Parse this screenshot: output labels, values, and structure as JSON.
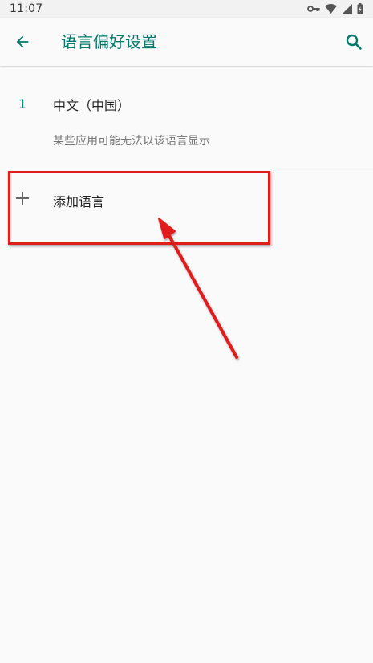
{
  "status_bar": {
    "time": "11:07",
    "icons": [
      "vpn-key-icon",
      "wifi-icon",
      "signal-icon",
      "battery-icon"
    ]
  },
  "app_bar": {
    "title": "语言偏好设置",
    "back_icon": "arrow-back-icon",
    "search_icon": "search-icon"
  },
  "languages": [
    {
      "index": "1",
      "name": "中文（中国）",
      "note": "某些应用可能无法以该语言显示"
    }
  ],
  "add_language": {
    "label": "添加语言",
    "icon": "plus-icon"
  },
  "colors": {
    "accent": "#00796b",
    "annotation": "#e21b1b",
    "background": "#fafafa"
  }
}
